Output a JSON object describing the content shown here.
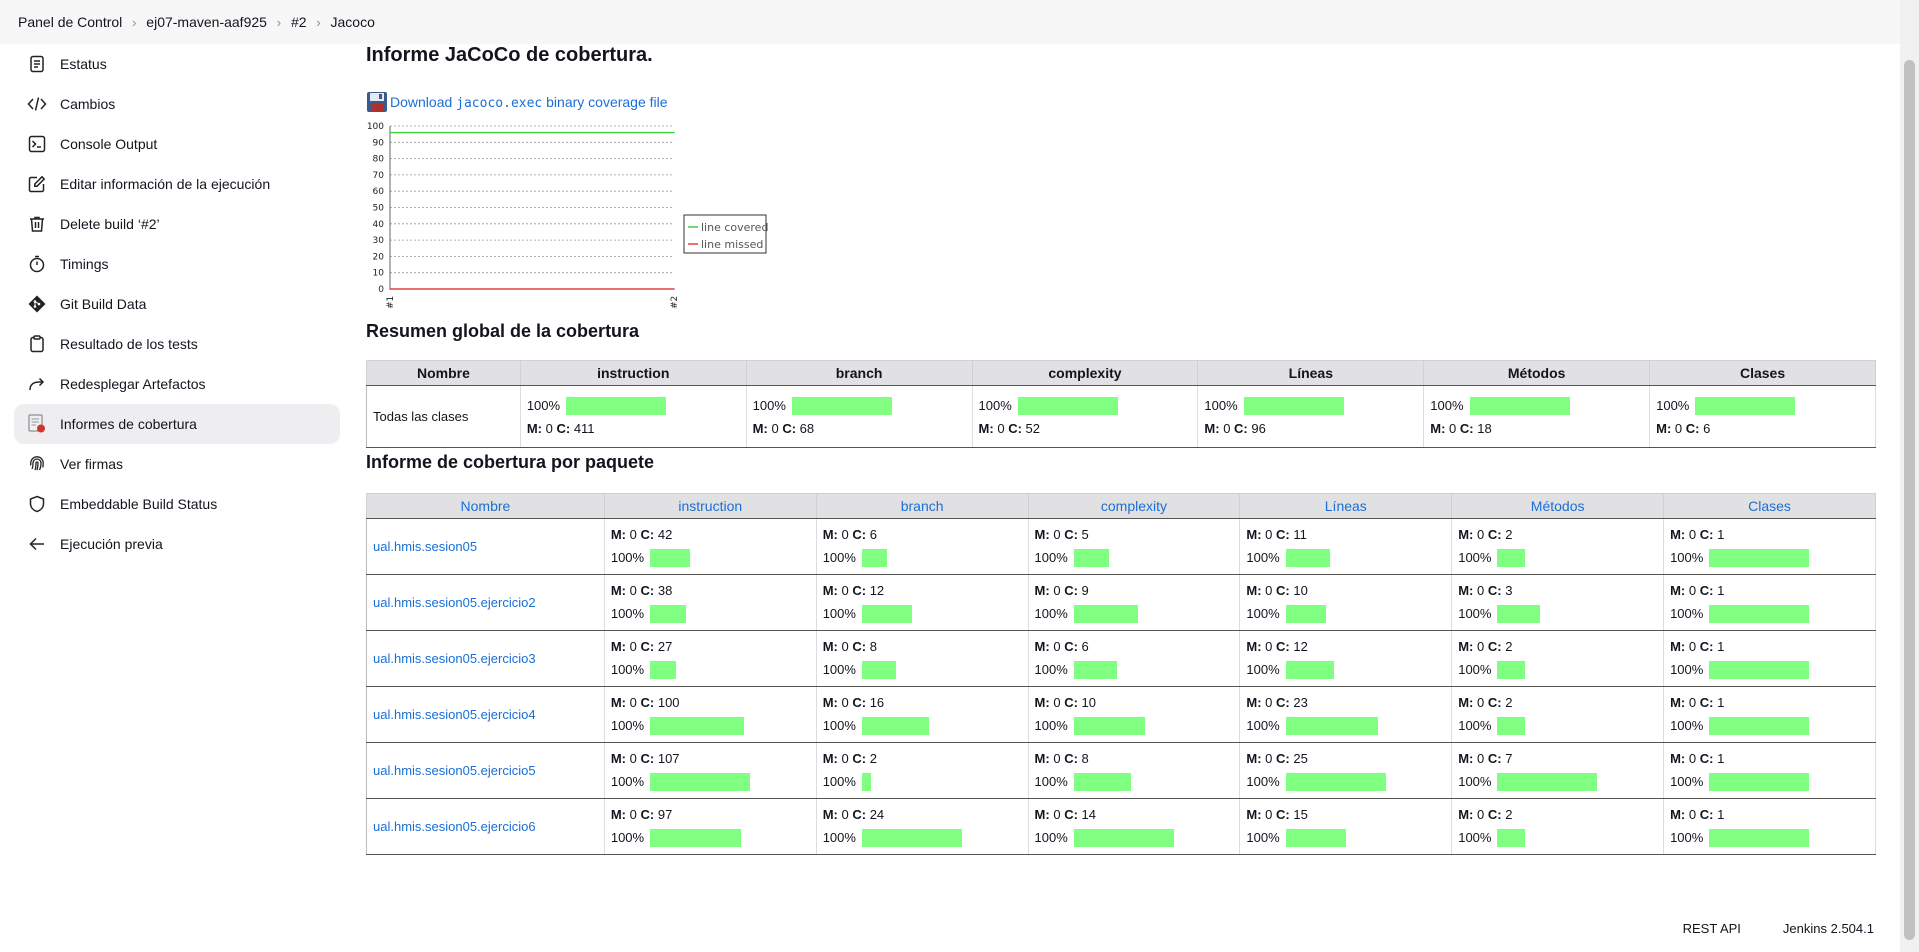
{
  "breadcrumb": [
    "Panel de Control",
    "ej07-maven-aaf925",
    "#2",
    "Jacoco"
  ],
  "sidebar": [
    {
      "label": "Estatus",
      "icon": "document-icon"
    },
    {
      "label": "Cambios",
      "icon": "code-icon"
    },
    {
      "label": "Console Output",
      "icon": "terminal-icon"
    },
    {
      "label": "Editar información de la ejecución",
      "icon": "edit-icon"
    },
    {
      "label": "Delete build ‘#2’",
      "icon": "trash-icon"
    },
    {
      "label": "Timings",
      "icon": "stopwatch-icon"
    },
    {
      "label": "Git Build Data",
      "icon": "git-icon"
    },
    {
      "label": "Resultado de los tests",
      "icon": "clipboard-icon"
    },
    {
      "label": "Redesplegar Artefactos",
      "icon": "redeploy-icon"
    },
    {
      "label": "Informes de cobertura",
      "icon": "coverage-report-icon"
    },
    {
      "label": "Ver firmas",
      "icon": "fingerprint-icon"
    },
    {
      "label": "Embeddable Build Status",
      "icon": "shield-icon"
    },
    {
      "label": "Ejecución previa",
      "icon": "arrow-left-icon"
    }
  ],
  "active_sidebar_index": 9,
  "title": "Informe JaCoCo de cobertura.",
  "download": {
    "prefix": "Download ",
    "code": "jacoco.exec",
    "suffix": " binary coverage file"
  },
  "chart_data": {
    "type": "line",
    "x": [
      "#1",
      "#2"
    ],
    "ylim": [
      0,
      100
    ],
    "yticks": [
      0,
      10,
      20,
      30,
      40,
      50,
      60,
      70,
      80,
      90,
      100
    ],
    "grid": true,
    "legend_position": "right",
    "series": [
      {
        "name": "line covered",
        "values": [
          96,
          96
        ],
        "color": "#40d040"
      },
      {
        "name": "line missed",
        "values": [
          0,
          0
        ],
        "color": "#e04040"
      }
    ]
  },
  "summary": {
    "heading": "Resumen global de la cobertura",
    "columns": [
      "Nombre",
      "instruction",
      "branch",
      "complexity",
      "Líneas",
      "Métodos",
      "Clases"
    ],
    "row": {
      "name": "Todas las clases",
      "cells": [
        {
          "pct": "100%",
          "m": "0",
          "c": "411",
          "ratio": 1
        },
        {
          "pct": "100%",
          "m": "0",
          "c": "68",
          "ratio": 1
        },
        {
          "pct": "100%",
          "m": "0",
          "c": "52",
          "ratio": 1
        },
        {
          "pct": "100%",
          "m": "0",
          "c": "96",
          "ratio": 1
        },
        {
          "pct": "100%",
          "m": "0",
          "c": "18",
          "ratio": 1
        },
        {
          "pct": "100%",
          "m": "0",
          "c": "6",
          "ratio": 1
        }
      ]
    }
  },
  "packages": {
    "heading": "Informe de cobertura por paquete",
    "columns": [
      "Nombre",
      "instruction",
      "branch",
      "complexity",
      "Líneas",
      "Métodos",
      "Clases"
    ],
    "rows": [
      {
        "name": "ual.hmis.sesion05",
        "cells": [
          {
            "m": "0",
            "c": "42",
            "pct": "100%",
            "ratio": 0.4
          },
          {
            "m": "0",
            "c": "6",
            "pct": "100%",
            "ratio": 0.25
          },
          {
            "m": "0",
            "c": "5",
            "pct": "100%",
            "ratio": 0.35
          },
          {
            "m": "0",
            "c": "11",
            "pct": "100%",
            "ratio": 0.44
          },
          {
            "m": "0",
            "c": "2",
            "pct": "100%",
            "ratio": 0.28
          },
          {
            "m": "0",
            "c": "1",
            "pct": "100%",
            "ratio": 1
          }
        ]
      },
      {
        "name": "ual.hmis.sesion05.ejercicio2",
        "cells": [
          {
            "m": "0",
            "c": "38",
            "pct": "100%",
            "ratio": 0.36
          },
          {
            "m": "0",
            "c": "12",
            "pct": "100%",
            "ratio": 0.5
          },
          {
            "m": "0",
            "c": "9",
            "pct": "100%",
            "ratio": 0.64
          },
          {
            "m": "0",
            "c": "10",
            "pct": "100%",
            "ratio": 0.4
          },
          {
            "m": "0",
            "c": "3",
            "pct": "100%",
            "ratio": 0.43
          },
          {
            "m": "0",
            "c": "1",
            "pct": "100%",
            "ratio": 1
          }
        ]
      },
      {
        "name": "ual.hmis.sesion05.ejercicio3",
        "cells": [
          {
            "m": "0",
            "c": "27",
            "pct": "100%",
            "ratio": 0.26
          },
          {
            "m": "0",
            "c": "8",
            "pct": "100%",
            "ratio": 0.34
          },
          {
            "m": "0",
            "c": "6",
            "pct": "100%",
            "ratio": 0.43
          },
          {
            "m": "0",
            "c": "12",
            "pct": "100%",
            "ratio": 0.48
          },
          {
            "m": "0",
            "c": "2",
            "pct": "100%",
            "ratio": 0.28
          },
          {
            "m": "0",
            "c": "1",
            "pct": "100%",
            "ratio": 1
          }
        ]
      },
      {
        "name": "ual.hmis.sesion05.ejercicio4",
        "cells": [
          {
            "m": "0",
            "c": "100",
            "pct": "100%",
            "ratio": 0.94
          },
          {
            "m": "0",
            "c": "16",
            "pct": "100%",
            "ratio": 0.67
          },
          {
            "m": "0",
            "c": "10",
            "pct": "100%",
            "ratio": 0.71
          },
          {
            "m": "0",
            "c": "23",
            "pct": "100%",
            "ratio": 0.92
          },
          {
            "m": "0",
            "c": "2",
            "pct": "100%",
            "ratio": 0.28
          },
          {
            "m": "0",
            "c": "1",
            "pct": "100%",
            "ratio": 1
          }
        ]
      },
      {
        "name": "ual.hmis.sesion05.ejercicio5",
        "cells": [
          {
            "m": "0",
            "c": "107",
            "pct": "100%",
            "ratio": 1
          },
          {
            "m": "0",
            "c": "2",
            "pct": "100%",
            "ratio": 0.09
          },
          {
            "m": "0",
            "c": "8",
            "pct": "100%",
            "ratio": 0.57
          },
          {
            "m": "0",
            "c": "25",
            "pct": "100%",
            "ratio": 1
          },
          {
            "m": "0",
            "c": "7",
            "pct": "100%",
            "ratio": 1
          },
          {
            "m": "0",
            "c": "1",
            "pct": "100%",
            "ratio": 1
          }
        ]
      },
      {
        "name": "ual.hmis.sesion05.ejercicio6",
        "cells": [
          {
            "m": "0",
            "c": "97",
            "pct": "100%",
            "ratio": 0.91
          },
          {
            "m": "0",
            "c": "24",
            "pct": "100%",
            "ratio": 1
          },
          {
            "m": "0",
            "c": "14",
            "pct": "100%",
            "ratio": 1
          },
          {
            "m": "0",
            "c": "15",
            "pct": "100%",
            "ratio": 0.6
          },
          {
            "m": "0",
            "c": "2",
            "pct": "100%",
            "ratio": 0.28
          },
          {
            "m": "0",
            "c": "1",
            "pct": "100%",
            "ratio": 1
          }
        ]
      }
    ]
  },
  "footer": {
    "rest_api": "REST API",
    "version": "Jenkins 2.504.1"
  }
}
